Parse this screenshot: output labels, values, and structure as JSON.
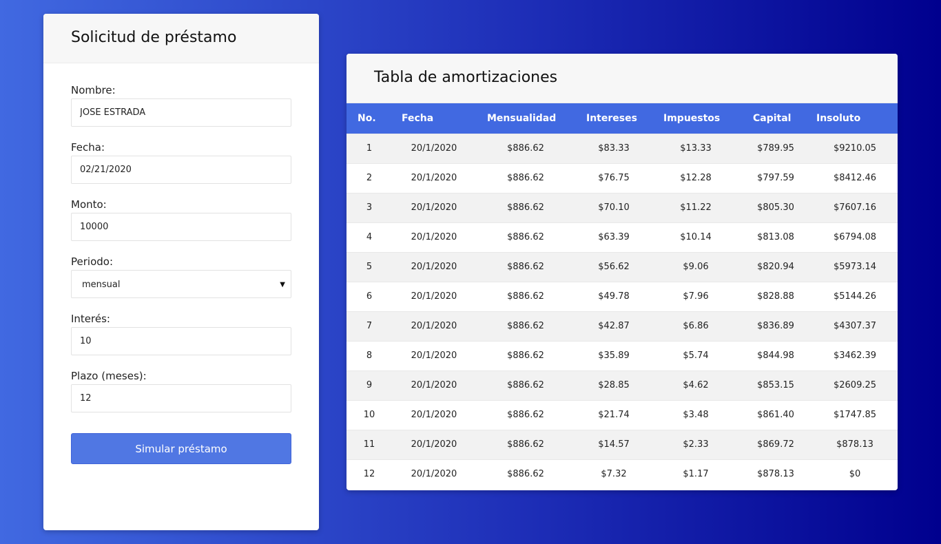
{
  "form": {
    "title": "Solicitud de préstamo",
    "fields": {
      "nombre": {
        "label": "Nombre:",
        "value": "JOSE ESTRADA"
      },
      "fecha": {
        "label": "Fecha:",
        "value": "02/21/2020"
      },
      "monto": {
        "label": "Monto:",
        "value": "10000"
      },
      "periodo": {
        "label": "Periodo:",
        "value": "mensual"
      },
      "interes": {
        "label": "Interés:",
        "value": "10"
      },
      "plazo": {
        "label": "Plazo (meses):",
        "value": "12"
      }
    },
    "submit_label": "Simular préstamo"
  },
  "table": {
    "title": "Tabla de amortizaciones",
    "headers": [
      "No.",
      "Fecha",
      "Mensualidad",
      "Intereses",
      "Impuestos",
      "Capital",
      "Insoluto"
    ],
    "rows": [
      [
        "1",
        "20/1/2020",
        "$886.62",
        "$83.33",
        "$13.33",
        "$789.95",
        "$9210.05"
      ],
      [
        "2",
        "20/1/2020",
        "$886.62",
        "$76.75",
        "$12.28",
        "$797.59",
        "$8412.46"
      ],
      [
        "3",
        "20/1/2020",
        "$886.62",
        "$70.10",
        "$11.22",
        "$805.30",
        "$7607.16"
      ],
      [
        "4",
        "20/1/2020",
        "$886.62",
        "$63.39",
        "$10.14",
        "$813.08",
        "$6794.08"
      ],
      [
        "5",
        "20/1/2020",
        "$886.62",
        "$56.62",
        "$9.06",
        "$820.94",
        "$5973.14"
      ],
      [
        "6",
        "20/1/2020",
        "$886.62",
        "$49.78",
        "$7.96",
        "$828.88",
        "$5144.26"
      ],
      [
        "7",
        "20/1/2020",
        "$886.62",
        "$42.87",
        "$6.86",
        "$836.89",
        "$4307.37"
      ],
      [
        "8",
        "20/1/2020",
        "$886.62",
        "$35.89",
        "$5.74",
        "$844.98",
        "$3462.39"
      ],
      [
        "9",
        "20/1/2020",
        "$886.62",
        "$28.85",
        "$4.62",
        "$853.15",
        "$2609.25"
      ],
      [
        "10",
        "20/1/2020",
        "$886.62",
        "$21.74",
        "$3.48",
        "$861.40",
        "$1747.85"
      ],
      [
        "11",
        "20/1/2020",
        "$886.62",
        "$14.57",
        "$2.33",
        "$869.72",
        "$878.13"
      ],
      [
        "12",
        "20/1/2020",
        "$886.62",
        "$7.32",
        "$1.17",
        "$878.13",
        "$0"
      ]
    ]
  },
  "colors": {
    "accent": "#4169e1",
    "button": "#5077e3",
    "background_start": "#4169e1",
    "background_end": "#00008e"
  },
  "icons": {
    "select_caret": "caret-down-icon"
  }
}
